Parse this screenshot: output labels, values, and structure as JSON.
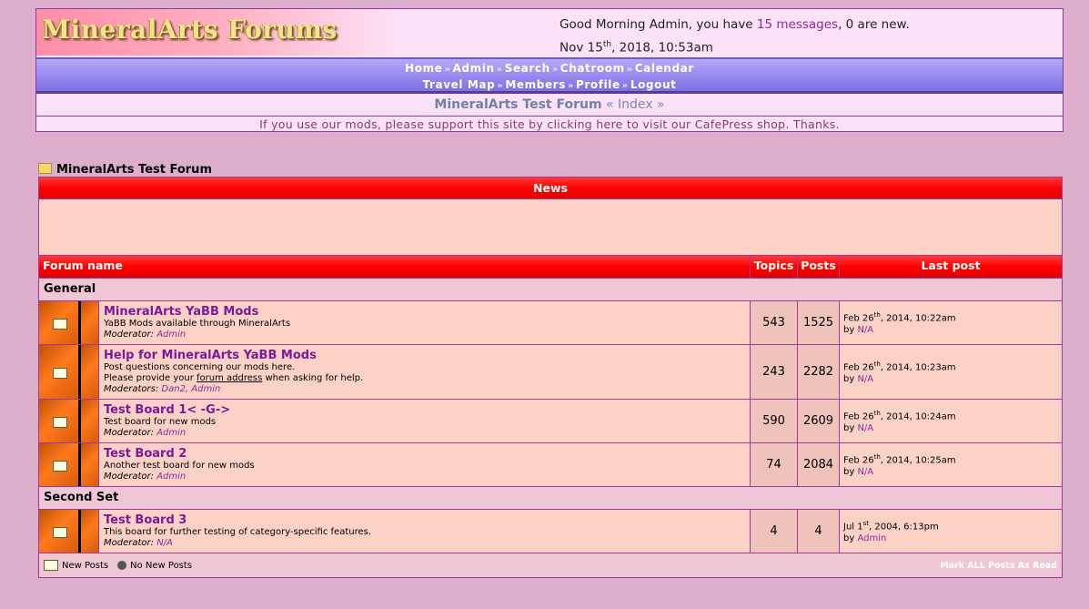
{
  "header": {
    "logo_text": "MineralArts Forums",
    "greeting_prefix": "Good Morning Admin, you have ",
    "messages_link": "15 messages",
    "greeting_suffix": ", 0 are new.",
    "date_day": "Nov 15",
    "date_sup": "th",
    "date_rest": ", 2018, 10:53am"
  },
  "nav": {
    "row1": [
      "Home",
      "Admin",
      "Search",
      "Chatroom",
      "Calendar"
    ],
    "row2": [
      "Travel Map",
      "Members",
      "Profile",
      "Logout"
    ]
  },
  "breadcrumb": {
    "forum": "MineralArts Test Forum",
    "sep": " « ",
    "index": "Index",
    "end": " »"
  },
  "support_text": "If you use our mods, please support this site by clicking here to visit our CafePress shop. Thanks.",
  "board_title": "MineralArts Test Forum",
  "news_header": "News",
  "columns": {
    "name": "Forum name",
    "topics": "Topics",
    "posts": "Posts",
    "last": "Last post"
  },
  "categories": [
    {
      "name": "General",
      "boards": [
        {
          "title": "MineralArts YaBB Mods",
          "desc": "YaBB Mods available through MineralArts",
          "desc2": "",
          "desc2_link": "",
          "desc2_end": "",
          "mod_label": "Moderator:",
          "mods": "Admin",
          "topics": "543",
          "posts": "1525",
          "last_date": "Feb 26",
          "last_sup": "th",
          "last_time": ", 2014, 10:22am",
          "last_by": "N/A"
        },
        {
          "title": "Help for MineralArts YaBB Mods",
          "desc": "Post questions concerning our mods here.",
          "desc2": "Please provide your ",
          "desc2_link": "forum address",
          "desc2_end": " when asking for help.",
          "mod_label": "Moderators:",
          "mods": "Dan2, Admin",
          "topics": "243",
          "posts": "2282",
          "last_date": "Feb 26",
          "last_sup": "th",
          "last_time": ", 2014, 10:23am",
          "last_by": "N/A"
        },
        {
          "title": "Test Board 1< -G->",
          "desc": "Test board for new mods",
          "desc2": "",
          "desc2_link": "",
          "desc2_end": "",
          "mod_label": "Moderator:",
          "mods": "Admin",
          "topics": "590",
          "posts": "2609",
          "last_date": "Feb 26",
          "last_sup": "th",
          "last_time": ", 2014, 10:24am",
          "last_by": "N/A"
        },
        {
          "title": "Test Board 2",
          "desc": "Another test board for new mods",
          "desc2": "",
          "desc2_link": "",
          "desc2_end": "",
          "mod_label": "Moderator:",
          "mods": "Admin",
          "topics": "74",
          "posts": "2084",
          "last_date": "Feb 26",
          "last_sup": "th",
          "last_time": ", 2014, 10:25am",
          "last_by": "N/A"
        }
      ]
    },
    {
      "name": "Second Set",
      "boards": [
        {
          "title": "Test Board 3",
          "desc": "This board for further testing of category-specific features.",
          "desc2": "",
          "desc2_link": "",
          "desc2_end": "",
          "mod_label": "Moderator:",
          "mods": "N/A",
          "topics": "4",
          "posts": "4",
          "last_date": "Jul 1",
          "last_sup": "st",
          "last_time": ", 2004, 6:13pm",
          "last_by": "Admin"
        }
      ]
    }
  ],
  "footer": {
    "new_posts": "New Posts",
    "no_new_posts": "No New Posts",
    "mark_all": "Mark ALL Posts As Read"
  }
}
